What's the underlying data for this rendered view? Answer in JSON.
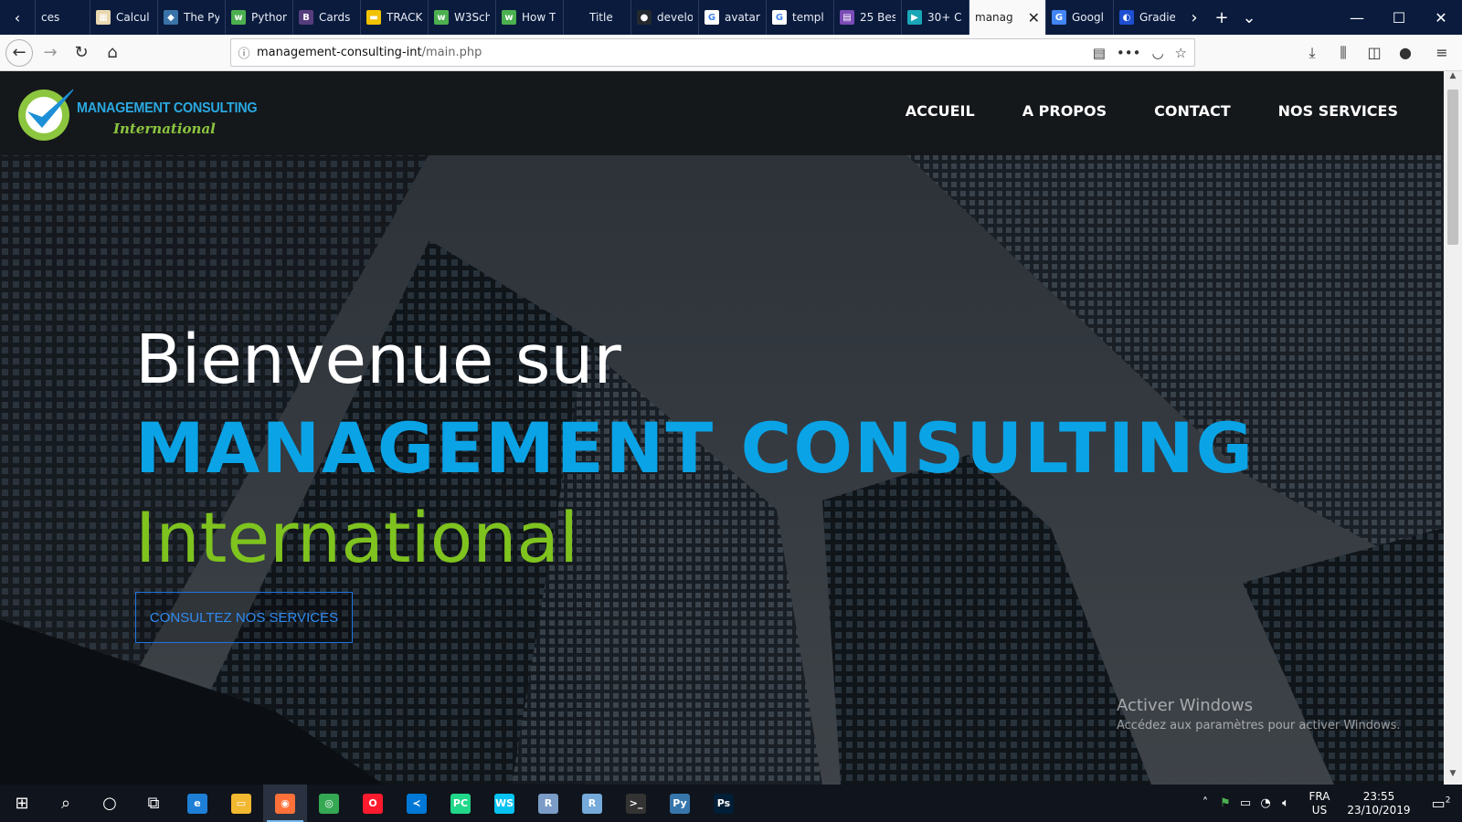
{
  "browser": {
    "tabs": [
      {
        "title": "ces",
        "fav": "#0a1b3d",
        "glyph": "‹"
      },
      {
        "title": "Calcul",
        "fav": "#e9d7b0",
        "glyph": "▦"
      },
      {
        "title": "The Py",
        "fav": "#3a73a8",
        "glyph": "◆"
      },
      {
        "title": "Python",
        "fav": "#4caf50",
        "glyph": "w"
      },
      {
        "title": "Cards",
        "fav": "#563d7c",
        "glyph": "B"
      },
      {
        "title": "TRACK",
        "fav": "#f2c200",
        "glyph": "▬"
      },
      {
        "title": "W3Sch",
        "fav": "#4caf50",
        "glyph": "w"
      },
      {
        "title": "How T",
        "fav": "#4caf50",
        "glyph": "w"
      },
      {
        "title": "Title",
        "fav": "#0a1b3d",
        "glyph": ""
      },
      {
        "title": "develo",
        "fav": "#24292e",
        "glyph": "●"
      },
      {
        "title": "avatar",
        "fav": "#ffffff",
        "glyph": "G"
      },
      {
        "title": "templ",
        "fav": "#ffffff",
        "glyph": "G"
      },
      {
        "title": "25 Bes",
        "fav": "#7b4bb7",
        "glyph": "▤"
      },
      {
        "title": "30+ C",
        "fav": "#1aa6b7",
        "glyph": "▶"
      },
      {
        "title": "manag",
        "fav": "",
        "glyph": "",
        "active": true
      },
      {
        "title": "Googl",
        "fav": "#4285f4",
        "glyph": "G"
      },
      {
        "title": "Gradie",
        "fav": "#1e4fd1",
        "glyph": "◐"
      }
    ],
    "url_host": "management-consulting-int",
    "url_path": "/main.php"
  },
  "site": {
    "logo_line1": "MANAGEMENT CONSULTING",
    "logo_line2": "International",
    "menu": [
      "ACCUEIL",
      "A PROPOS",
      "CONTACT",
      "NOS SERVICES"
    ],
    "hero_line1": "Bienvenue sur",
    "hero_line2": "MANAGEMENT CONSULTING",
    "hero_line3": "International",
    "cta": "CONSULTEZ NOS SERVICES",
    "colors": {
      "blue": "#0aa3e6",
      "green": "#7fc31f"
    }
  },
  "windows_watermark": {
    "title": "Activer Windows",
    "subtitle": "Accédez aux paramètres pour activer Windows."
  },
  "taskbar": {
    "apps": [
      {
        "name": "edge",
        "color": "#1e7fd6",
        "glyph": "e"
      },
      {
        "name": "explorer",
        "color": "#f2b830",
        "glyph": "▭"
      },
      {
        "name": "firefox",
        "color": "#ff7139",
        "glyph": "◉",
        "active": true
      },
      {
        "name": "chrome",
        "color": "#34a853",
        "glyph": "◎"
      },
      {
        "name": "opera",
        "color": "#ff1b2d",
        "glyph": "O"
      },
      {
        "name": "vscode",
        "color": "#0078d7",
        "glyph": "≺"
      },
      {
        "name": "pycharm",
        "color": "#21d789",
        "glyph": "PC"
      },
      {
        "name": "webstorm",
        "color": "#07c3f2",
        "glyph": "WS"
      },
      {
        "name": "r",
        "color": "#7a9cc6",
        "glyph": "R"
      },
      {
        "name": "rstudio",
        "color": "#75aadb",
        "glyph": "R"
      },
      {
        "name": "terminal",
        "color": "#333333",
        "glyph": ">_"
      },
      {
        "name": "python",
        "color": "#3776ab",
        "glyph": "Py"
      },
      {
        "name": "photoshop",
        "color": "#001e36",
        "glyph": "Ps"
      }
    ],
    "lang_line1": "FRA",
    "lang_line2": "US",
    "time": "23:55",
    "date": "23/10/2019",
    "notifications": "2"
  }
}
